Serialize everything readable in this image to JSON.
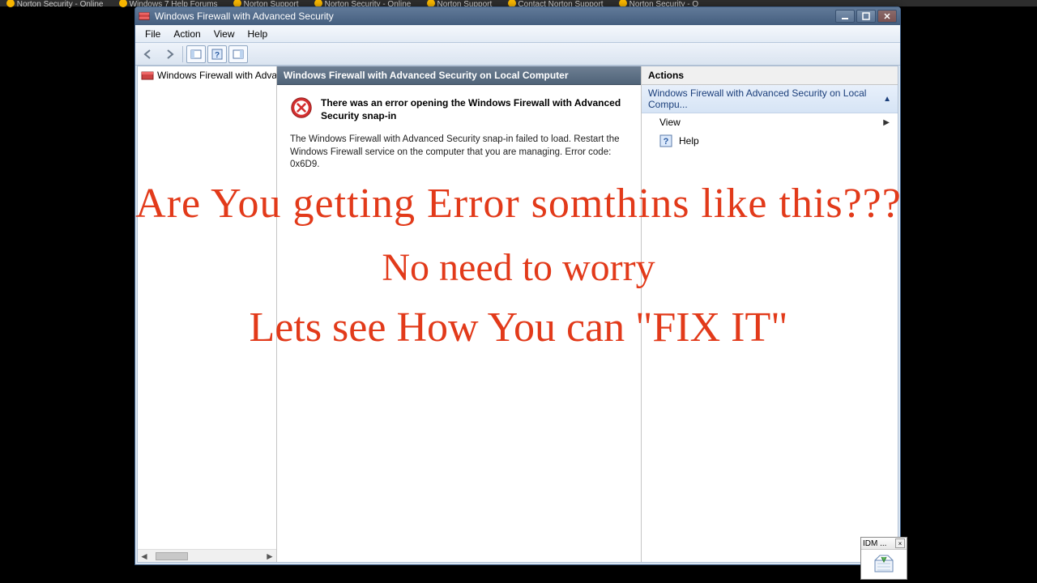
{
  "browser_tabs": [
    "Norton Security - Online",
    "Windows 7 Help Forums",
    "Norton Support",
    "Norton Security - Online",
    "Norton Support",
    "Contact Norton Support",
    "Norton Security - O"
  ],
  "window": {
    "title": "Windows Firewall with Advanced Security"
  },
  "menubar": {
    "file": "File",
    "action": "Action",
    "view": "View",
    "help": "Help"
  },
  "tree": {
    "root": "Windows Firewall with Advance"
  },
  "center": {
    "header": "Windows Firewall with Advanced Security on Local Computer",
    "error_title": "There was an error opening the Windows Firewall with Advanced Security snap-in",
    "error_detail": "The Windows Firewall with Advanced Security snap-in failed to load.  Restart the Windows Firewall service on the computer that you are managing. Error code: 0x6D9."
  },
  "actions": {
    "header": "Actions",
    "group_title": "Windows Firewall with Advanced Security on Local Compu...",
    "view": "View",
    "help": "Help"
  },
  "overlay": {
    "line1": "Are You getting Error somthins like this???",
    "line2": "No need to worry",
    "line3": "Lets see How You can \"FIX IT\""
  },
  "idm": {
    "title": "IDM ..."
  }
}
